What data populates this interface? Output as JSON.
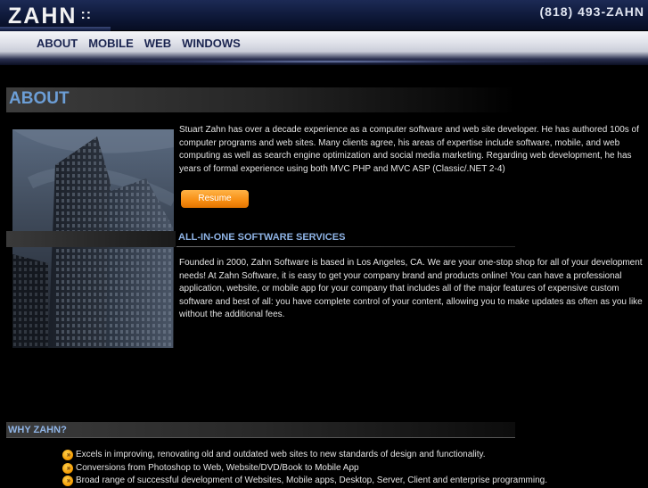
{
  "header": {
    "logo_text": "ZAHN",
    "logo_dots": "::",
    "phone": "(818) 493-ZAHN"
  },
  "nav": {
    "items": [
      {
        "label": "ABOUT"
      },
      {
        "label": "MOBILE"
      },
      {
        "label": "WEB"
      },
      {
        "label": "WINDOWS"
      }
    ]
  },
  "main": {
    "title": "ABOUT",
    "intro": "Stuart Zahn has over a decade experience as a computer software and web site developer. He has authored 100s of computer programs and web sites. Many clients agree, his areas of expertise include software, mobile, and web computing as well as search engine optimization and social media marketing. Regarding web development, he has years of formal experience using both MVC PHP and MVC ASP (Classic/.NET 2-4)",
    "resume_label": "Resume",
    "services_title": "ALL-IN-ONE SOFTWARE SERVICES",
    "services_text": "Founded in 2000, Zahn Software is based in Los Angeles, CA. We are your one-stop shop for all of your development needs! At Zahn Software, it is easy to get your company brand and products online! You can have a professional application, website, or mobile app for your company that includes all of the major features of expensive custom software and best of all: you have complete control of your content, allowing you to make updates as often as you like without the additional fees.",
    "why_title": "WHY ZAHN?",
    "why_items": [
      "Excels in improving, renovating old and outdated web sites to new standards of design and functionality.",
      "Conversions from Photoshop to Web, Website/DVD/Book to Mobile App",
      "Broad range of successful development of Websites, Mobile apps, Desktop, Server, Client and enterprise programming."
    ]
  },
  "icons": {
    "bullet": "double-chevron-right-icon"
  }
}
